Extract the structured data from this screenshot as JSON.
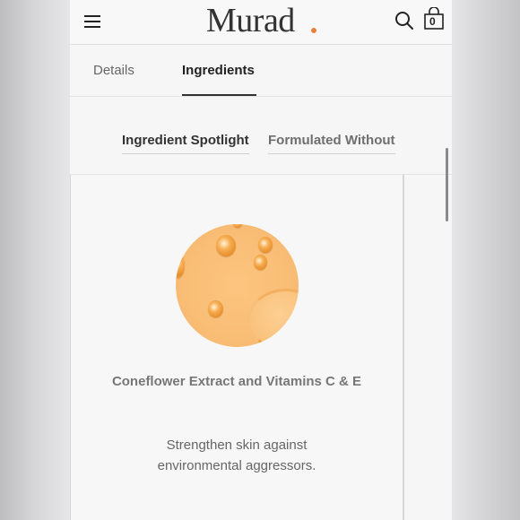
{
  "header": {
    "logo": "Murad",
    "cart_count": "0",
    "icons": [
      "hamburger-menu-icon",
      "search-icon",
      "shopping-bag-icon"
    ]
  },
  "tabs": [
    {
      "label": "Details",
      "active": false
    },
    {
      "label": "Ingredients",
      "active": true
    }
  ],
  "subtabs": [
    {
      "label": "Ingredient Spotlight",
      "active": true
    },
    {
      "label": "Formulated Without",
      "active": false
    }
  ],
  "spotlight": {
    "title": "Coneflower Extract and Vitamins C & E",
    "description": "Strengthen skin against environmental aggressors."
  },
  "colors": {
    "brand_dot": "#e8823a",
    "ingredient_orange": "#f9bd76",
    "active_text": "#222222"
  }
}
